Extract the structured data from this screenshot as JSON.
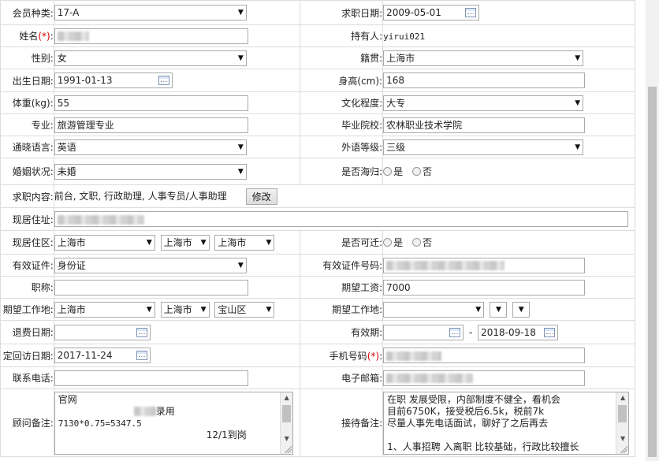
{
  "form": {
    "member_type": {
      "label": "会员种类:",
      "value": "17-A"
    },
    "job_date": {
      "label": "求职日期:",
      "value": "2009-05-01"
    },
    "name": {
      "label": "姓名",
      "req": "(*)",
      "label_end": ":"
    },
    "holder": {
      "label": "持有人:",
      "value": "yirui021"
    },
    "gender": {
      "label": "性别:",
      "value": "女"
    },
    "native": {
      "label": "籍贯:",
      "value": "上海市"
    },
    "birth": {
      "label": "出生日期:",
      "value": "1991-01-13"
    },
    "height": {
      "label": "身高(cm):",
      "value": "168"
    },
    "weight": {
      "label": "体重(kg):",
      "value": "55"
    },
    "education": {
      "label": "文化程度:",
      "value": "大专"
    },
    "major": {
      "label": "专业:",
      "value": "旅游管理专业"
    },
    "school": {
      "label": "毕业院校:",
      "value": "农林职业技术学院"
    },
    "language": {
      "label": "通晓语言:",
      "value": "英语"
    },
    "lang_level": {
      "label": "外语等级:",
      "value": "三级"
    },
    "marital": {
      "label": "婚姻状况:",
      "value": "未婚"
    },
    "overseas": {
      "label": "是否海归:",
      "yes": "是",
      "no": "否"
    },
    "job_content": {
      "label": "求职内容:",
      "value": "前台, 文职, 行政助理, 人事专员/人事助理",
      "button": "修改"
    },
    "address": {
      "label": "现居住址:"
    },
    "area": {
      "label": "现居住区:",
      "v1": "上海市",
      "v2": "上海市",
      "v3": "上海市"
    },
    "relocate": {
      "label": "是否可迁:",
      "yes": "是",
      "no": "否"
    },
    "id_type": {
      "label": "有效证件:",
      "value": "身份证"
    },
    "id_number": {
      "label": "有效证件号码:"
    },
    "title": {
      "label": "职称:"
    },
    "salary": {
      "label": "期望工资:",
      "value": "7000"
    },
    "work_place": {
      "label": "期望工作地:",
      "v1": "上海市",
      "v2": "上海市",
      "v3": "宝山区"
    },
    "work_place2": {
      "label": "期望工作地:"
    },
    "refund_date": {
      "label": "退费日期:"
    },
    "validity": {
      "label": "有效期:",
      "sep": "-",
      "end": "2018-09-18"
    },
    "revisit": {
      "label": "定回访日期:",
      "value": "2017-11-24"
    },
    "mobile": {
      "label": "手机号码",
      "req": "(*)",
      "label_end": ":"
    },
    "phone": {
      "label": "联系电话:"
    },
    "email": {
      "label": "电子邮箱:"
    },
    "consultant_note": {
      "label": "顾问备注:",
      "line1": "官网",
      "line2_suffix": "录用",
      "line3": "7130*0.75=5347.5",
      "line4": "12/1到岗"
    },
    "reception_note": {
      "label": "接待备注:",
      "line1": "在职 发展受限，内部制度不健全，看机会",
      "line2": "目前6750K，接受税后6.5k，税前7k",
      "line3": "尽量人事先电话面试，聊好了之后再去",
      "line4": "",
      "line5": "1、人事招聘 入离职 比较基础，行政比较擅长"
    }
  }
}
